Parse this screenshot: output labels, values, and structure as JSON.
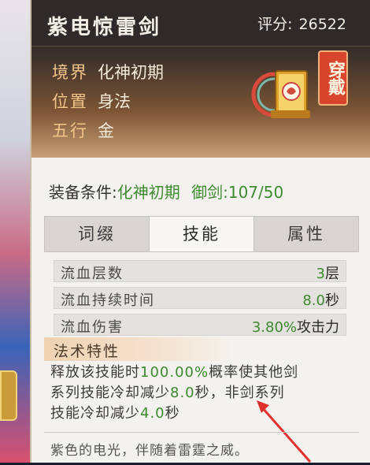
{
  "item": {
    "title": "紫电惊雷剑",
    "score_label": "评分:",
    "score_value": "26522",
    "wear_label": "穿戴",
    "realm_key": "境界",
    "realm_value": "化神初期",
    "position_key": "位置",
    "position_value": "身法",
    "element_key": "五行",
    "element_value": "金",
    "icon": "book-scroll-icon"
  },
  "equip": {
    "label": "装备条件:",
    "realm": "化神初期",
    "sword_label": "御剑:",
    "sword_value": "107/50"
  },
  "tabs": [
    "词缀",
    "技能",
    "属性"
  ],
  "active_tab": 1,
  "stats": [
    {
      "name": "流血层数",
      "value": "3",
      "unit": "层"
    },
    {
      "name": "流血持续时间",
      "value": "8.0",
      "unit": "秒"
    },
    {
      "name": "流血伤害",
      "value": "3.80%",
      "unit": "攻击力"
    }
  ],
  "spell": {
    "header": "法术特性",
    "line1_a": "释放该技能时",
    "line1_b": "100.00%",
    "line1_c": "概率使其他剑",
    "line2_a": "系列技能冷却减少",
    "line2_b": "8.0",
    "line2_c": "秒，非剑系列",
    "line3_a": "技能冷却减少",
    "line3_b": "4.0",
    "line3_c": "秒"
  },
  "flavor": "紫色的电光，伴随着雷霆之威。",
  "colors": {
    "accent_green": "#3d8a2f",
    "wear_red": "#d6452c",
    "key_gold": "#f2c58a",
    "arrow_red": "#e0312e"
  }
}
